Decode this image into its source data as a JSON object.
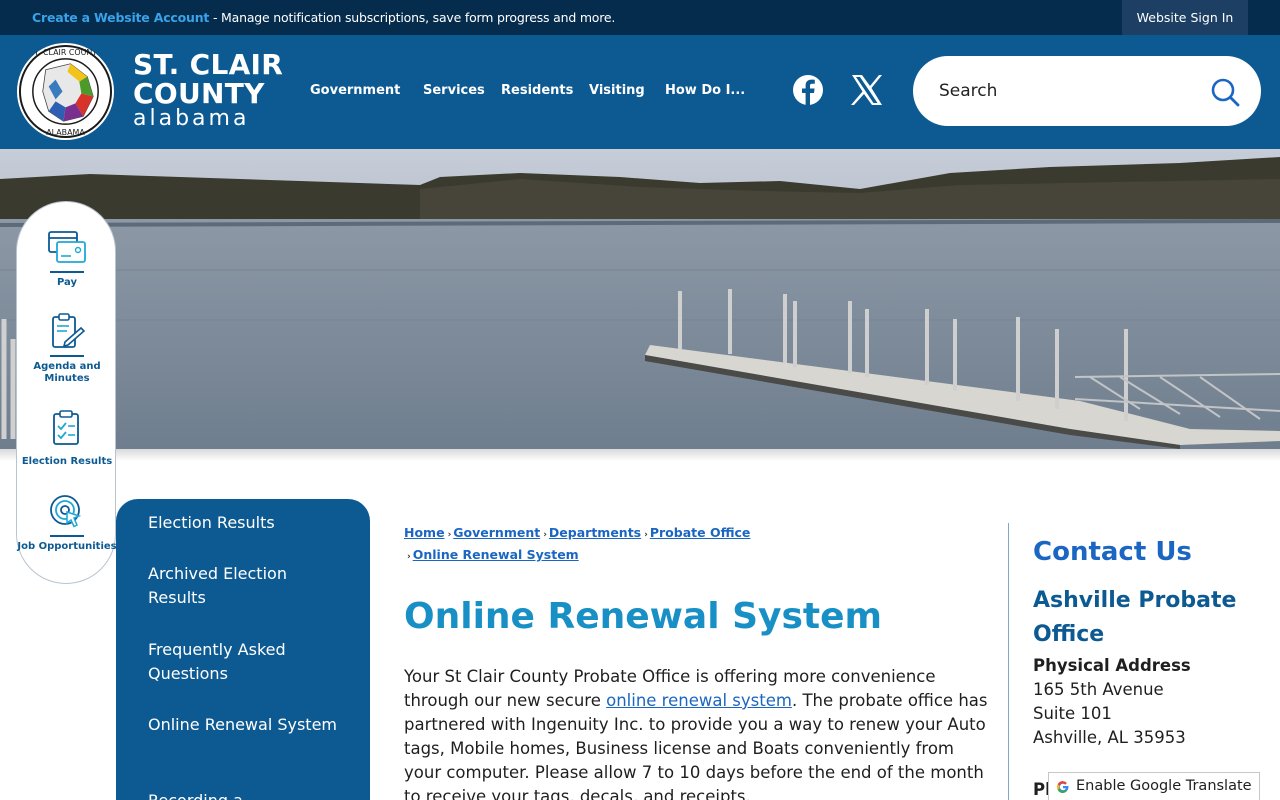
{
  "topbar": {
    "create_account": "Create a Website Account",
    "message": " - Manage notification subscriptions, save form progress and more.",
    "sign_in": "Website Sign In"
  },
  "header": {
    "logo_line1": "ST. CLAIR",
    "logo_line2": "COUNTY",
    "logo_line3": "alabama",
    "seal_icon": "county-seal-icon",
    "nav": [
      "Government",
      "Services",
      "Residents",
      "Visiting",
      "How Do I..."
    ],
    "social": [
      "facebook-icon",
      "x-twitter-icon"
    ],
    "search_placeholder": "Search"
  },
  "quick_links": [
    {
      "label": "Pay",
      "icon": "payment-card-icon"
    },
    {
      "label": "Agenda and Minutes",
      "icon": "agenda-clipboard-icon"
    },
    {
      "label": "Election Results",
      "icon": "election-clipboard-icon"
    },
    {
      "label": "Job Opportunities",
      "icon": "target-cursor-icon"
    }
  ],
  "side_menu": [
    "Election Results",
    "Archived Election Results",
    "Frequently Asked Questions",
    "Online Renewal System",
    "Recording a"
  ],
  "breadcrumb": [
    "Home",
    "Government",
    "Departments",
    "Probate Office",
    "Online Renewal System"
  ],
  "page_title": "Online Renewal System",
  "intro": {
    "before_link": "Your St Clair County Probate Office is offering more convenience through our new secure ",
    "link": "online renewal system",
    "after_link": ". The probate office has partnered with Ingenuity Inc. to provide you a way to renew your Auto tags, Mobile homes, Business license and Boats conveniently from your computer. Please allow 7 to 10 days before the end of the month to receive your tags, decals, and receipts."
  },
  "contact": {
    "title": "Contact Us",
    "office": "Ashville Probate Office",
    "address_label": "Physical Address",
    "address": [
      "165 5th Avenue",
      "Suite 101",
      "Ashville, AL 35953"
    ],
    "phone_peek": "Ph"
  },
  "translate": {
    "label": "Enable Google Translate"
  },
  "colors": {
    "topbar": "#062c4d",
    "header": "#0d5a93",
    "accent_link": "#1a66c2",
    "title": "#1890c6"
  }
}
